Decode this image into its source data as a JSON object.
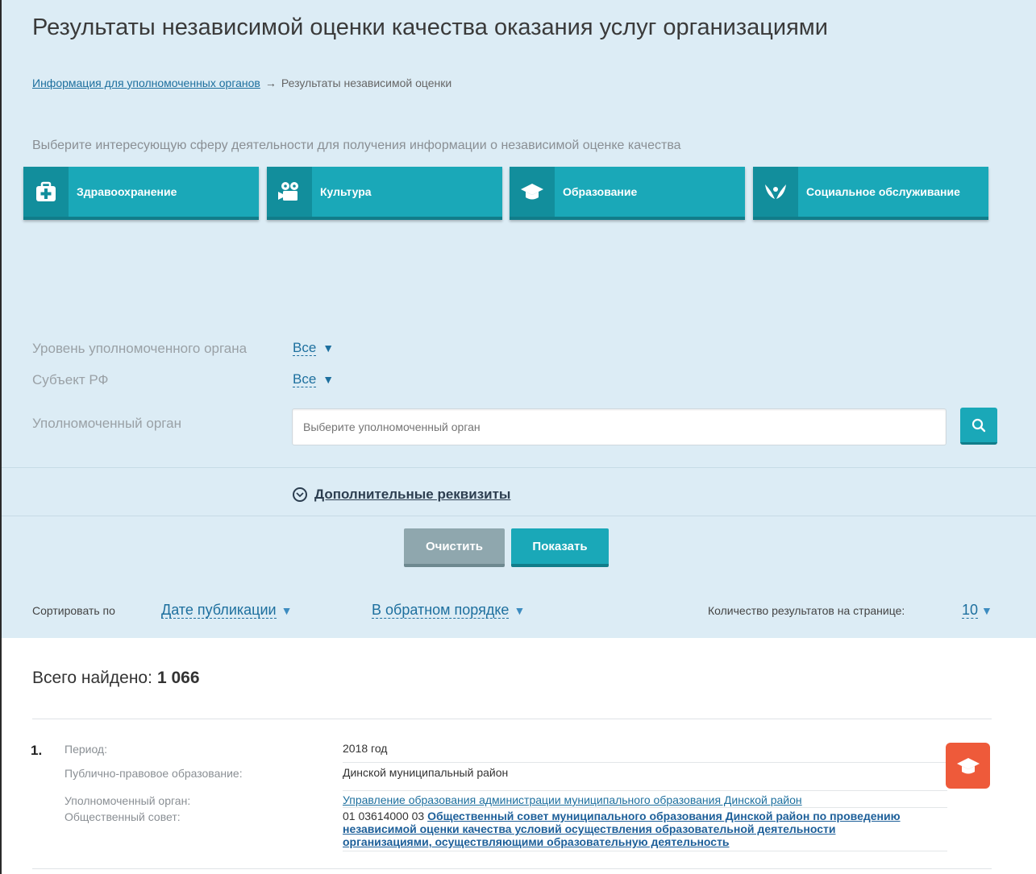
{
  "page_title": "Результаты независимой оценки качества оказания услуг организациями",
  "breadcrumb": {
    "link": "Информация для уполномоченных органов",
    "separator": "→",
    "current": "Результаты независимой оценки"
  },
  "intro": "Выберите интересующую сферу деятельности для получения информации о независимой оценке качества",
  "spheres": [
    {
      "label": "Здравоохранение",
      "icon": "medical-kit-icon"
    },
    {
      "label": "Культура",
      "icon": "film-camera-icon"
    },
    {
      "label": "Образование",
      "icon": "graduation-cap-icon"
    },
    {
      "label": "Социальное обслуживание",
      "icon": "caring-hands-icon"
    }
  ],
  "filters": {
    "level_label": "Уровень уполномоченного органа",
    "level_value": "Все",
    "subject_label": "Субъект РФ",
    "subject_value": "Все",
    "organ_label": "Уполномоченный орган",
    "organ_placeholder": "Выберите уполномоченный орган",
    "extra_label": "Дополнительные реквизиты"
  },
  "buttons": {
    "clear": "Очистить",
    "show": "Показать"
  },
  "sorting": {
    "label": "Сортировать по",
    "field": "Дате публикации",
    "order": "В обратном порядке",
    "count_label": "Количество результатов на странице:",
    "count_value": "10"
  },
  "results": {
    "total_label": "Всего найдено:",
    "total_value": "1 066",
    "items": [
      {
        "number": "1.",
        "period_label": "Период:",
        "period_value": "2018 год",
        "entity_label": "Публично-правовое образование:",
        "entity_value": "Динской муниципальный район",
        "organ_label": "Уполномоченный орган:",
        "organ_value": "Управление образования администрации муниципального образования Динской район",
        "council_label": "Общественный совет:",
        "council_code": "01 03614000 03",
        "council_value": "Общественный совет муниципального образования Динской район по проведению независимой оценки качества условий осуществления образовательной деятельности организациями, осуществляющими образовательную деятельность",
        "badge_icon": "graduation-cap-icon"
      }
    ]
  },
  "colors": {
    "accent": "#1aa8b8",
    "accent_dark": "#117d8a",
    "link": "#1d6f9e",
    "panel": "#dcecf5",
    "badge": "#ee5a3a",
    "clear_button": "#8fa7ae"
  }
}
